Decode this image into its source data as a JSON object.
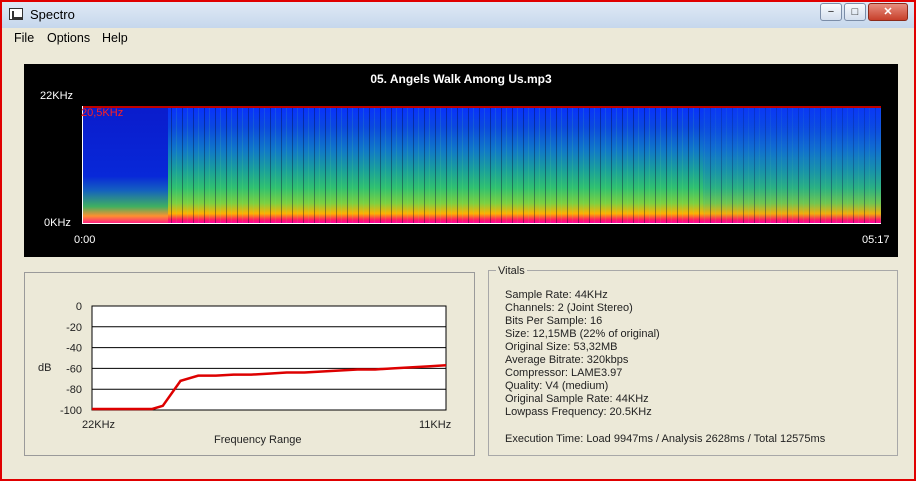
{
  "window": {
    "title": "Spectro",
    "controls": {
      "minimize": "−",
      "maximize": "□",
      "close": "✕"
    }
  },
  "menu": {
    "items": [
      "File",
      "Options",
      "Help"
    ]
  },
  "spectrogram": {
    "title": "05. Angels Walk Among Us.mp3",
    "y_top_label": "22KHz",
    "y_bottom_label": "0KHz",
    "x_start_label": "0:00",
    "x_end_label": "05:17",
    "lowpass_label": "20,5KHz",
    "colors": {
      "lowpass": "#c00000",
      "background": "#000000"
    }
  },
  "chart_data": {
    "type": "line",
    "title": "",
    "xlabel": "Frequency Range",
    "ylabel": "dB",
    "x_tick_labels": [
      "22KHz",
      "11KHz"
    ],
    "y_ticks": [
      0,
      -20,
      -40,
      -60,
      -80,
      -100
    ],
    "ylim": [
      -100,
      0
    ],
    "grid": true,
    "series": [
      {
        "color": "#dd0000",
        "x": [
          0,
          0.08,
          0.15,
          0.17,
          0.2,
          0.25,
          0.3,
          0.35,
          0.4,
          0.45,
          0.5,
          0.55,
          0.6,
          0.65,
          0.7,
          0.75,
          0.8,
          0.85,
          0.9,
          0.95,
          1.0
        ],
        "values": [
          -99,
          -99,
          -99,
          -99,
          -96,
          -72,
          -67,
          -67,
          -66,
          -66,
          -65,
          -64,
          -64,
          -63,
          -62,
          -61,
          -61,
          -60,
          -59,
          -58,
          -57
        ]
      }
    ]
  },
  "vitals": {
    "legend": "Vitals",
    "lines": [
      "Sample Rate: 44KHz",
      "Channels: 2 (Joint Stereo)",
      "Bits Per Sample: 16",
      "Size: 12,15MB (22% of original)",
      "Original Size: 53,32MB",
      "Average Bitrate: 320kbps",
      "Compressor: LAME3.97",
      "Quality: V4 (medium)",
      "Original Sample Rate: 44KHz",
      "Lowpass Frequency: 20.5KHz"
    ],
    "execution": "Execution Time: Load 9947ms / Analysis 2628ms / Total 12575ms"
  }
}
